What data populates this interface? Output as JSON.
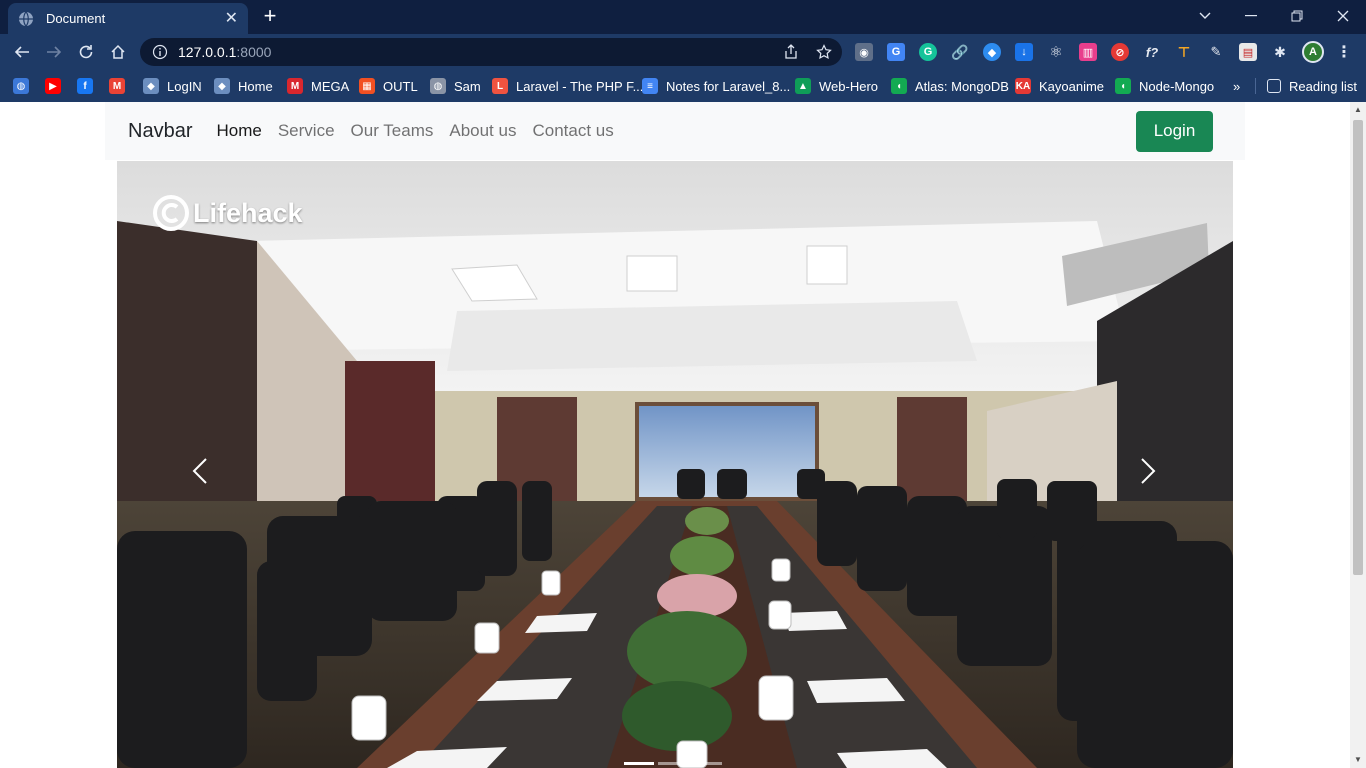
{
  "browser": {
    "tab_title": "Document",
    "url_host": "127.0.0.1",
    "url_port": ":8000",
    "bookmarks": [
      {
        "label": "",
        "icon": "globe-icon",
        "color": "#3c78d8"
      },
      {
        "label": "",
        "icon": "youtube-icon",
        "color": "#ff0000"
      },
      {
        "label": "",
        "icon": "facebook-icon",
        "color": "#1877f2"
      },
      {
        "label": "",
        "icon": "gmail-icon",
        "color": "#ea4335"
      },
      {
        "label": "LogIN",
        "icon": "shield-icon",
        "color": "#6c8ebf"
      },
      {
        "label": "Home",
        "icon": "shield-icon",
        "color": "#6c8ebf"
      },
      {
        "label": "MEGA",
        "icon": "mega-icon",
        "color": "#d9272e"
      },
      {
        "label": "OUTL",
        "icon": "windows-icon",
        "color": "#f25022"
      },
      {
        "label": "Sam",
        "icon": "globe-icon",
        "color": "#8a94a6"
      },
      {
        "label": "Laravel - The PHP F...",
        "icon": "laravel-icon",
        "color": "#f05340"
      },
      {
        "label": "Notes for Laravel_8...",
        "icon": "docs-icon",
        "color": "#4285f4"
      },
      {
        "label": "Web-Hero",
        "icon": "drive-icon",
        "color": "#0f9d58"
      },
      {
        "label": "Atlas: MongoDB",
        "icon": "mongodb-icon",
        "color": "#13aa52"
      },
      {
        "label": "Kayoanime",
        "icon": "ka-icon",
        "color": "#e53935"
      },
      {
        "label": "Node-Mongo",
        "icon": "mongodb-icon",
        "color": "#13aa52"
      }
    ],
    "reading_list": "Reading list",
    "more_bookmarks": "»"
  },
  "page": {
    "brand": "Navbar",
    "nav": [
      "Home",
      "Service",
      "Our Teams",
      "About us",
      "Contact us"
    ],
    "active_index": 0,
    "login_label": "Login",
    "carousel_logo": "Lifehack",
    "carousel_indicator_count": 3,
    "carousel_active_indicator": 0,
    "colors": {
      "primary_green": "#198754",
      "navbar_bg": "#f8f9fa"
    }
  }
}
